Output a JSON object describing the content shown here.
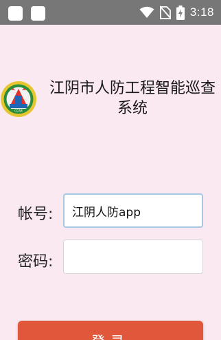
{
  "status_bar": {
    "time": "3:18",
    "icons": [
      "notification-square-icon",
      "notification-square-icon",
      "wifi-icon",
      "no-sim-icon",
      "battery-charging-icon"
    ]
  },
  "header": {
    "logo_icon": "ccab-civil-defense-emblem-icon",
    "title": "江阴市人防工程智能巡查系统"
  },
  "form": {
    "account_label": "帐号:",
    "account_value": "江阴人防app",
    "password_label": "密码:",
    "password_value": ""
  },
  "actions": {
    "login_label": "登录"
  },
  "colors": {
    "background": "#fbe9f1",
    "status_bar": "#777777",
    "login_button": "#e0573b",
    "focus_border": "#a7c7e7"
  }
}
